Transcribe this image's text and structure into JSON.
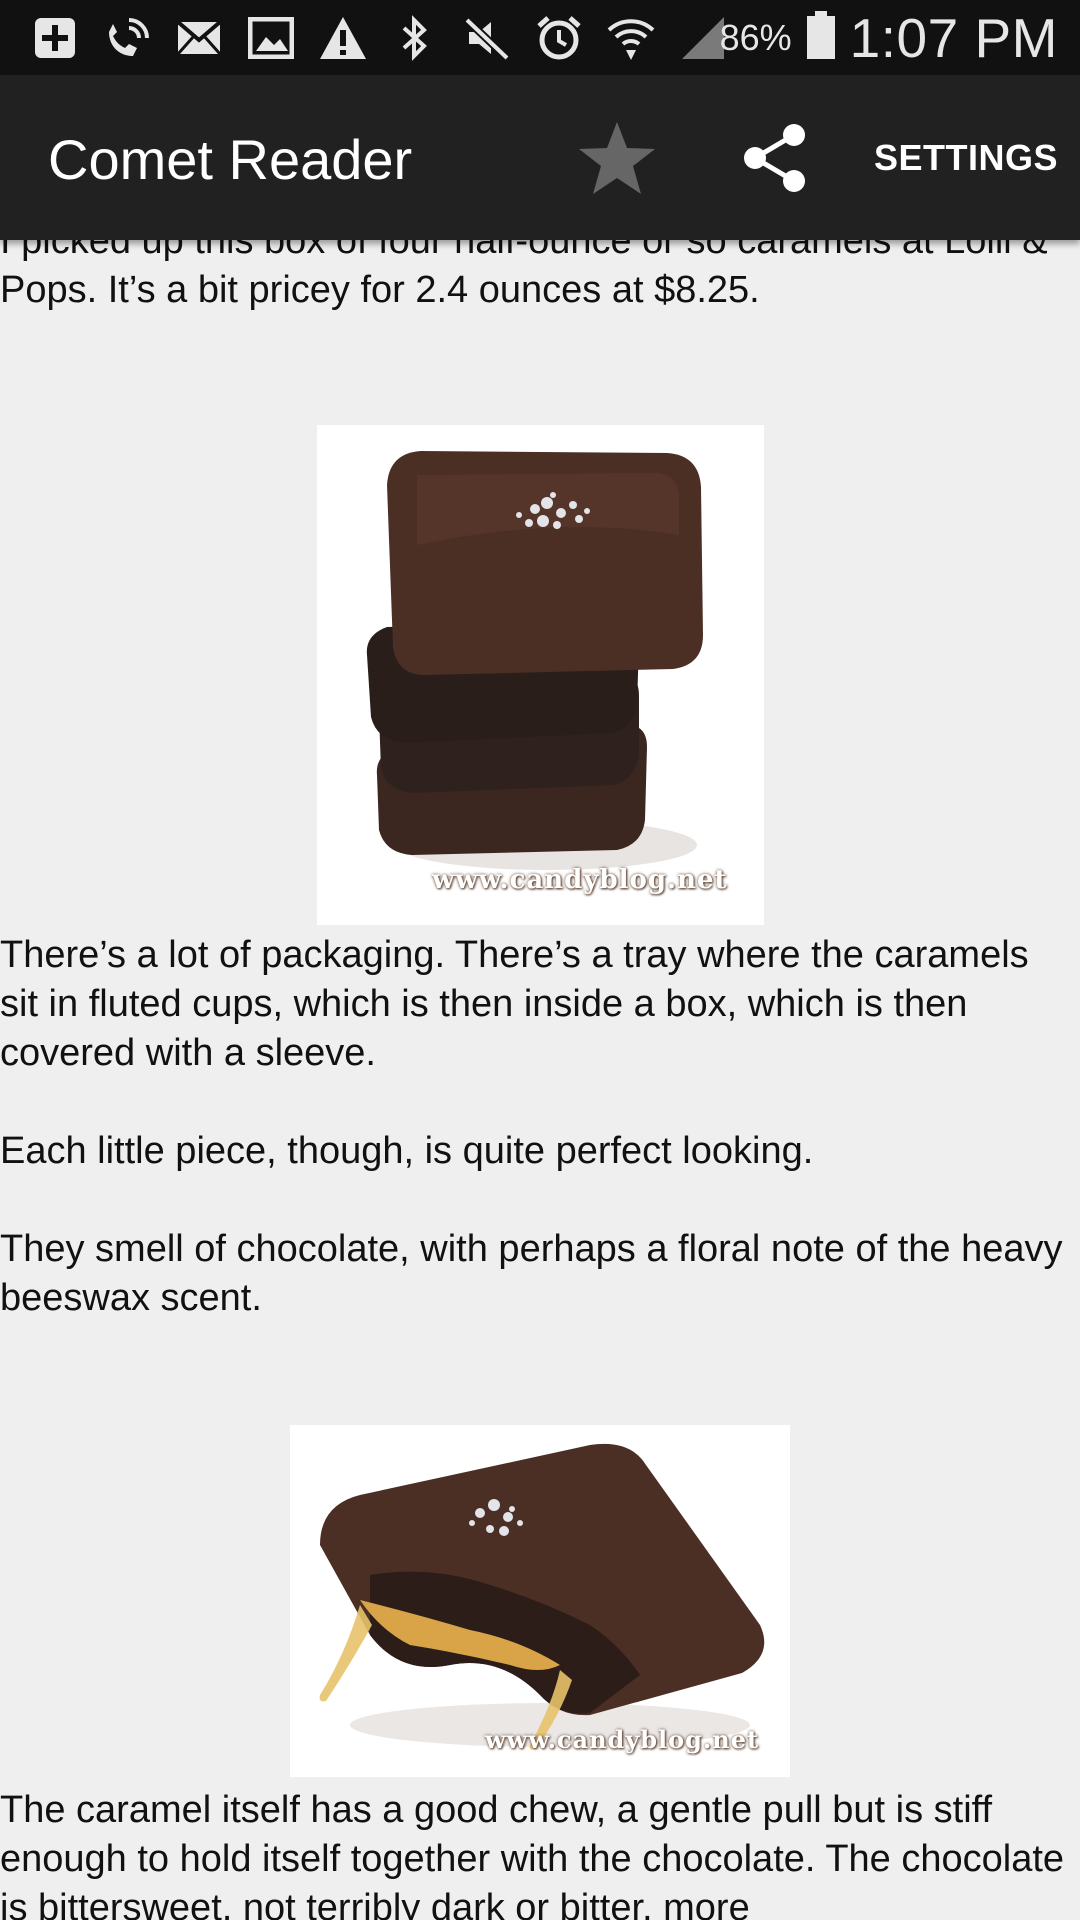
{
  "status_bar": {
    "icons": [
      "add-box-icon",
      "wifi-calling-icon",
      "mail-icon",
      "image-icon",
      "warning-icon",
      "bluetooth-icon",
      "mute-icon",
      "alarm-icon",
      "wifi-icon",
      "signal-icon",
      "battery-icon"
    ],
    "battery": "86%",
    "time": "1:07 PM"
  },
  "app_bar": {
    "title": "Comet Reader",
    "settings_label": "SETTINGS"
  },
  "article": {
    "para_1": "I picked up this box of four half-ounce or so caramels at Lolli & Pops. It’s a bit pricey for 2.4 ounces at $8.25.",
    "image_1_watermark": "www.candyblog.net",
    "para_2": "There’s a lot of packaging. There’s a tray where the caramels sit in fluted cups, which is then inside a box, which is then covered with a sleeve.",
    "para_3": "Each little piece, though, is quite perfect looking.",
    "para_4": "They smell of chocolate, with perhaps a floral note of the heavy beeswax scent.",
    "image_2_watermark": "www.candyblog.net",
    "para_5": "The caramel itself has a good chew, a gentle pull but is stiff enough to hold itself together with the chocolate. The chocolate is bittersweet, not terribly dark or bitter, more"
  },
  "colors": {
    "status_bar_bg": "#111111",
    "app_bar_bg": "#212121",
    "content_bg": "#efefef",
    "chocolate": "#4a2e22"
  }
}
